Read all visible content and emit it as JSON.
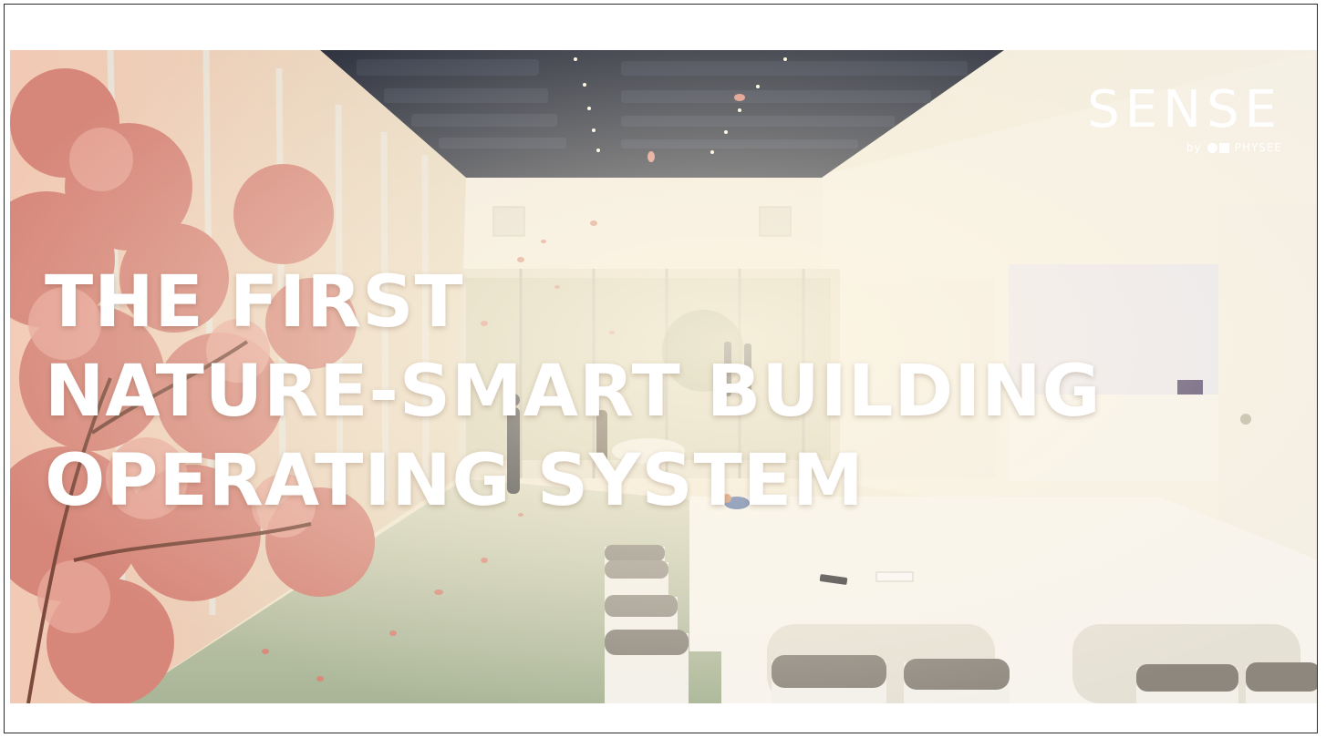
{
  "headline": {
    "line1": "THE FIRST",
    "line2": "NATURE-SMART BUILDING",
    "line3": "OPERATING SYSTEM"
  },
  "logo": {
    "word": "SENSE",
    "by": "by",
    "brand": "PHYSEE",
    "mark_icon": "physee-logo-mark"
  },
  "colors": {
    "headline_text": "#ffffff",
    "ceiling": "#1f2433",
    "blossom": "#d98a7a",
    "floor": "#b9c3a8",
    "wall": "#f3ecdc"
  }
}
